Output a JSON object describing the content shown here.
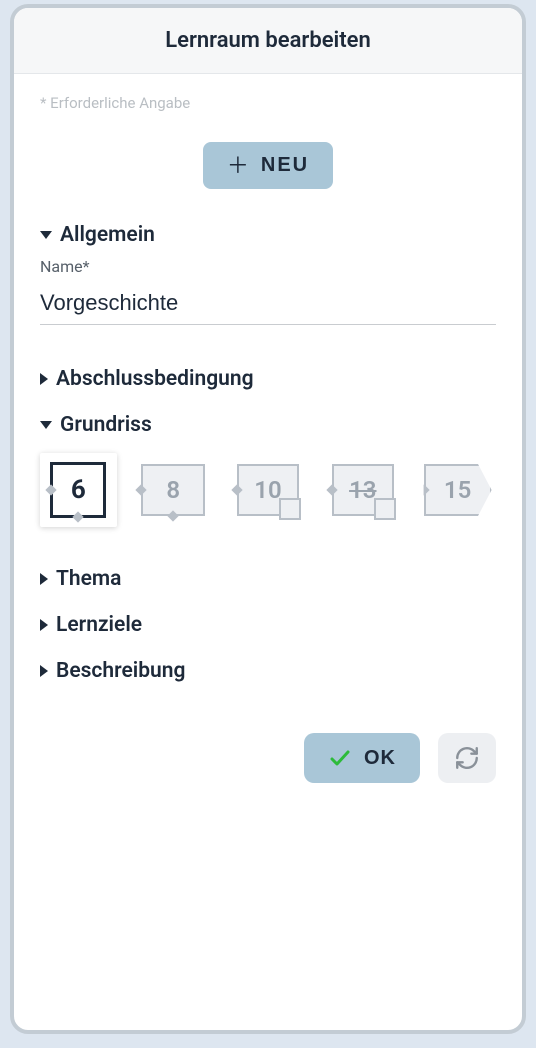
{
  "title": "Lernraum bearbeiten",
  "hint": "* Erforderliche Angabe",
  "neu": {
    "label": "NEU"
  },
  "sections": {
    "allgemein": {
      "label": "Allgemein",
      "fields": {
        "name": {
          "label": "Name*",
          "value": "Vorgeschichte"
        }
      }
    },
    "abschluss": {
      "label": "Abschlussbedingung"
    },
    "grundriss": {
      "label": "Grundriss",
      "options": [
        {
          "value": "6",
          "active": true
        },
        {
          "value": "8",
          "active": false
        },
        {
          "value": "10",
          "active": false
        },
        {
          "value": "13",
          "active": false
        },
        {
          "value": "15",
          "active": false
        }
      ]
    },
    "thema": {
      "label": "Thema"
    },
    "lernziele": {
      "label": "Lernziele"
    },
    "beschreibung": {
      "label": "Beschreibung"
    }
  },
  "footer": {
    "ok": "OK"
  }
}
